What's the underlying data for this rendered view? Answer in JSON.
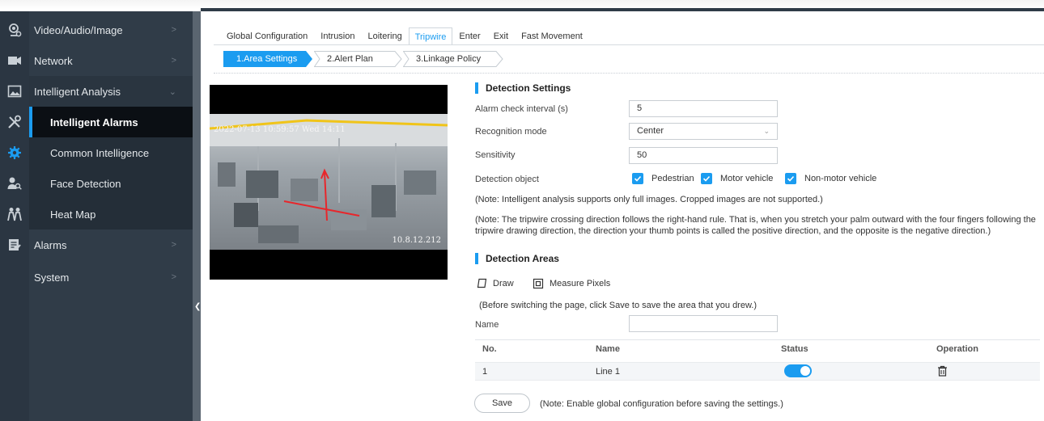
{
  "nav": {
    "items": [
      {
        "label": "Video/Audio/Image",
        "icon": "camera-gear-icon"
      },
      {
        "label": "Network",
        "icon": "network-icon"
      },
      {
        "label": "Intelligent Analysis",
        "icon": "image-icon"
      },
      {
        "label": "Intelligent Alarms",
        "icon": "tools-icon",
        "active": true
      },
      {
        "label": "Common Intelligence",
        "icon": "gear-icon"
      },
      {
        "label": "Face Detection",
        "icon": "face-search-icon"
      },
      {
        "label": "Heat Map",
        "icon": "people-icon"
      },
      {
        "label": "Alarms",
        "icon": "alarm-log-icon"
      },
      {
        "label": "System",
        "icon": "system-icon"
      }
    ]
  },
  "tabs": [
    "Global Configuration",
    "Intrusion",
    "Loitering",
    "Tripwire",
    "Enter",
    "Exit",
    "Fast Movement"
  ],
  "active_tab": "Tripwire",
  "steps": [
    "1.Area Settings",
    "2.Alert Plan",
    "3.Linkage Policy"
  ],
  "video": {
    "timestamp": "2022-07-13 10:59:57 Wed 14:11",
    "ip_overlay": "10.8.12.212"
  },
  "detection_settings": {
    "title": "Detection Settings",
    "alarm_interval_label": "Alarm check interval (s)",
    "alarm_interval_value": "5",
    "recognition_label": "Recognition mode",
    "recognition_value": "Center",
    "sensitivity_label": "Sensitivity",
    "sensitivity_value": "50",
    "object_label": "Detection object",
    "objects": [
      "Pedestrian",
      "Motor vehicle",
      "Non-motor vehicle"
    ],
    "note1": "(Note: Intelligent analysis supports only full images. Cropped images are not supported.)",
    "note2a": "(Note: The tripwire crossing direction follows the right-hand rule. That is, when you stretch your palm outward with the four fingers following the",
    "note2b": "tripwire drawing direction, the direction your thumb points is called the positive direction, and the opposite is the negative direction.)"
  },
  "detection_areas": {
    "title": "Detection Areas",
    "draw_label": "Draw",
    "measure_label": "Measure Pixels",
    "hint": "(Before switching the page, click Save to save the area that you drew.)",
    "name_label": "Name",
    "name_value": "",
    "table": {
      "headers": [
        "No.",
        "Name",
        "Status",
        "Operation"
      ],
      "rows": [
        {
          "no": "1",
          "name": "Line 1",
          "status": "on"
        }
      ]
    }
  },
  "footer": {
    "save_label": "Save",
    "save_note": "(Note: Enable global configuration before saving the settings.)"
  },
  "colors": {
    "accent": "#1b9cf0",
    "sidebar": "#303c48",
    "rail": "#2b3642",
    "active_item": "#0b0f14"
  }
}
